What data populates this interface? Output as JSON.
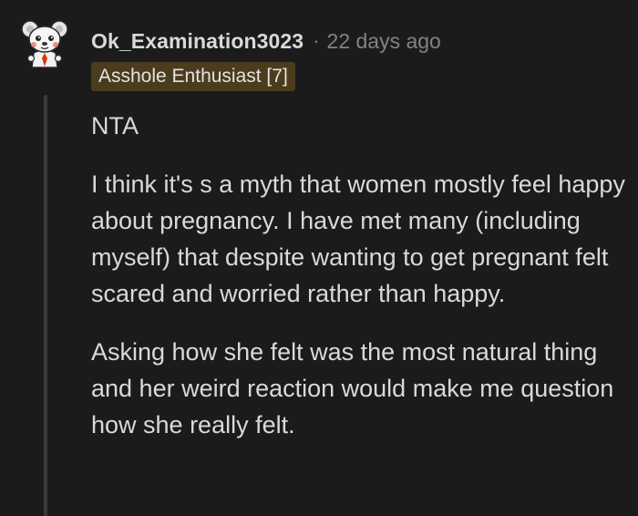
{
  "comment": {
    "username": "Ok_Examination3023",
    "separator": "·",
    "timestamp": "22 days ago",
    "flair": "Asshole Enthusiast [7]",
    "paragraphs": [
      "NTA",
      "I think it's s a myth that women mostly feel happy about pregnancy. I have met many (including myself) that despite wanting to get pregnant felt scared and worried rather than happy.",
      "Asking how she felt was the most natural thing and her weird reaction would make me question how she really felt."
    ]
  },
  "icons": {
    "avatar": "snoo-avatar-icon"
  },
  "colors": {
    "background": "#1b1b1b",
    "text": "#d7dadc",
    "meta": "#818384",
    "flair_bg": "#4a3c1d",
    "thread_line": "#3a3a3a"
  }
}
